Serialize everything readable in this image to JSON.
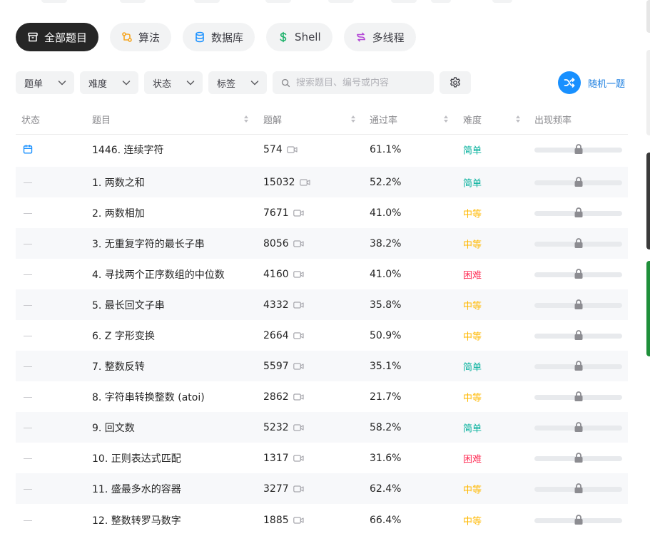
{
  "categories": [
    {
      "label": "全部题目",
      "icon": "archive-icon",
      "active": true
    },
    {
      "label": "算法",
      "icon": "algorithm-icon",
      "color": "#f5a623"
    },
    {
      "label": "数据库",
      "icon": "database-icon",
      "color": "#1890ff"
    },
    {
      "label": "Shell",
      "icon": "dollar-icon",
      "color": "#20b26c"
    },
    {
      "label": "多线程",
      "icon": "thread-icon",
      "color": "#b348d6"
    }
  ],
  "filters": {
    "list": "题单",
    "difficulty": "难度",
    "status": "状态",
    "tags": "标签",
    "search_placeholder": "搜索题目、编号或内容",
    "search_value": ""
  },
  "random": {
    "label": "随机一题"
  },
  "columns": {
    "status": "状态",
    "title": "题目",
    "solutions": "题解",
    "acceptance": "通过率",
    "difficulty": "难度",
    "frequency": "出现频率"
  },
  "difficulty_colors": {
    "简单": "#00af9b",
    "中等": "#ffb800",
    "困难": "#ff2d55"
  },
  "problems": [
    {
      "status": "daily",
      "title": "1446. 连续字符",
      "solutions": "574",
      "acceptance": "61.1%",
      "difficulty": "简单"
    },
    {
      "status": "none",
      "title": "1. 两数之和",
      "solutions": "15032",
      "acceptance": "52.2%",
      "difficulty": "简单"
    },
    {
      "status": "none",
      "title": "2. 两数相加",
      "solutions": "7671",
      "acceptance": "41.0%",
      "difficulty": "中等"
    },
    {
      "status": "none",
      "title": "3. 无重复字符的最长子串",
      "solutions": "8056",
      "acceptance": "38.2%",
      "difficulty": "中等"
    },
    {
      "status": "none",
      "title": "4. 寻找两个正序数组的中位数",
      "solutions": "4160",
      "acceptance": "41.0%",
      "difficulty": "困难"
    },
    {
      "status": "none",
      "title": "5. 最长回文子串",
      "solutions": "4332",
      "acceptance": "35.8%",
      "difficulty": "中等"
    },
    {
      "status": "none",
      "title": "6. Z 字形变换",
      "solutions": "2664",
      "acceptance": "50.9%",
      "difficulty": "中等"
    },
    {
      "status": "none",
      "title": "7. 整数反转",
      "solutions": "5597",
      "acceptance": "35.1%",
      "difficulty": "简单"
    },
    {
      "status": "none",
      "title": "8. 字符串转换整数 (atoi)",
      "solutions": "2862",
      "acceptance": "21.7%",
      "difficulty": "中等"
    },
    {
      "status": "none",
      "title": "9. 回文数",
      "solutions": "5232",
      "acceptance": "58.2%",
      "difficulty": "简单"
    },
    {
      "status": "none",
      "title": "10. 正则表达式匹配",
      "solutions": "1317",
      "acceptance": "31.6%",
      "difficulty": "困难"
    },
    {
      "status": "none",
      "title": "11. 盛最多水的容器",
      "solutions": "3277",
      "acceptance": "62.4%",
      "difficulty": "中等"
    },
    {
      "status": "none",
      "title": "12. 整数转罗马数字",
      "solutions": "1885",
      "acceptance": "66.4%",
      "difficulty": "中等"
    }
  ]
}
